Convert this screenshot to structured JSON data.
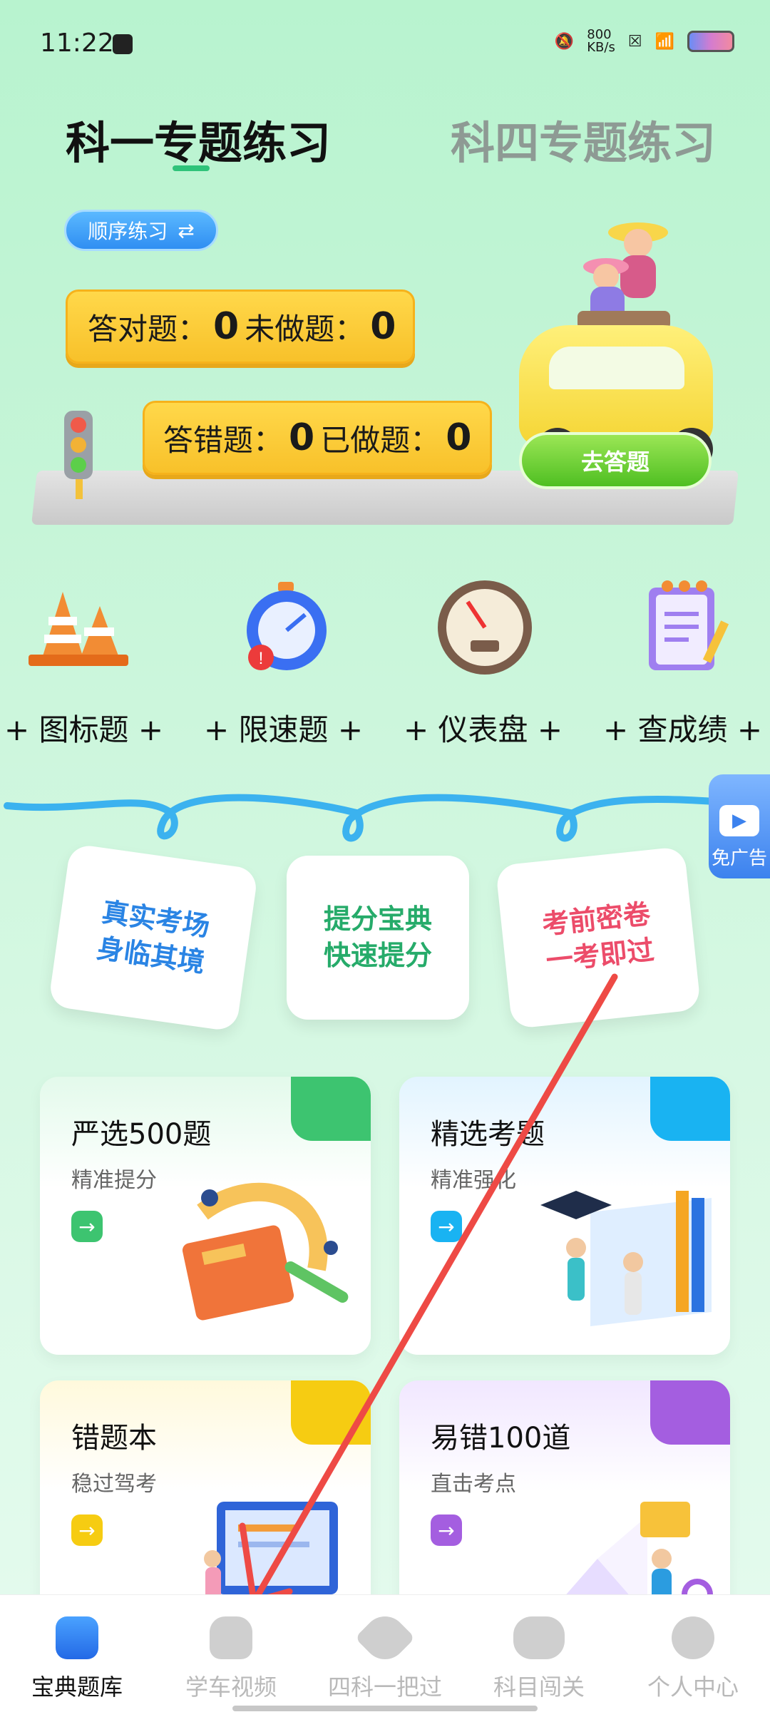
{
  "status_bar": {
    "time": "11:22",
    "net_speed_top": "800",
    "net_speed_unit": "KB/s"
  },
  "tabs": {
    "active": "科一专题练习",
    "inactive": "科四专题练习"
  },
  "sequence_mode": {
    "label": "顺序练习",
    "icon": "swap-arrows-icon"
  },
  "stats": {
    "correct_label": "答对题：",
    "correct_value": "0",
    "undone_label": "未做题：",
    "undone_value": "0",
    "wrong_label": "答错题：",
    "wrong_value": "0",
    "done_label": "已做题：",
    "done_value": "0"
  },
  "go_answer_button": "去答题",
  "quick_links": [
    {
      "label": "+ 图标题 +",
      "icon": "traffic-cone-icon"
    },
    {
      "label": "+ 限速题 +",
      "icon": "stopwatch-icon"
    },
    {
      "label": "+ 仪表盘 +",
      "icon": "speedometer-icon"
    },
    {
      "label": "+ 查成绩 +",
      "icon": "notepad-icon"
    }
  ],
  "tags": [
    {
      "line1": "真实考场",
      "line2": "身临其境"
    },
    {
      "line1": "提分宝典",
      "line2": "快速提分"
    },
    {
      "line1": "考前密卷",
      "line2": "一考即过"
    }
  ],
  "ad_float_label": "免广告",
  "cards": [
    {
      "title": "严选500题",
      "subtitle": "精准提分",
      "color": "#3dc470"
    },
    {
      "title": "精选考题",
      "subtitle": "精准强化",
      "color": "#19b3f2"
    },
    {
      "title": "错题本",
      "subtitle": "稳过驾考",
      "color": "#f6cc12"
    },
    {
      "title": "易错100道",
      "subtitle": "直击考点",
      "color": "#a45ee0"
    }
  ],
  "bottom_nav": [
    {
      "label": "宝典题库",
      "icon": "folder-icon",
      "active": true
    },
    {
      "label": "学车视频",
      "icon": "kettlebell-icon",
      "active": false
    },
    {
      "label": "四科一把过",
      "icon": "rocket-icon",
      "active": false
    },
    {
      "label": "科目闯关",
      "icon": "gamepad-icon",
      "active": false
    },
    {
      "label": "个人中心",
      "icon": "face-icon",
      "active": false
    }
  ],
  "colors": {
    "accent_green": "#2fc37a",
    "annotation_arrow": "#ee4a45"
  }
}
